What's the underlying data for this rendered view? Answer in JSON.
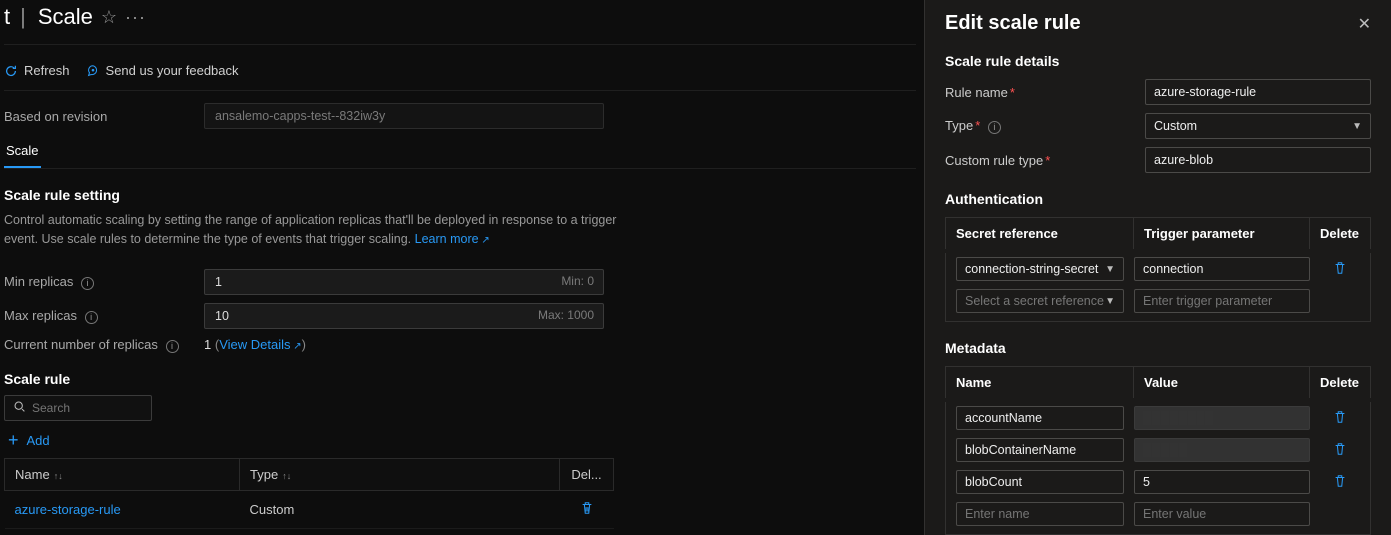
{
  "breadcrumb": {
    "suffix": "t",
    "page": "Scale"
  },
  "toolbar": {
    "refresh": "Refresh",
    "feedback": "Send us your feedback"
  },
  "revision": {
    "label": "Based on revision",
    "value": "ansalemo-capps-test--832iw3y"
  },
  "tabs": {
    "scale": "Scale"
  },
  "setting_header": "Scale rule setting",
  "setting_desc": "Control automatic scaling by setting the range of application replicas that'll be deployed in response to a trigger event. Use scale rules to determine the type of events that trigger scaling.",
  "learn_more": "Learn more",
  "min": {
    "label": "Min replicas",
    "value": "1",
    "hint": "Min: 0"
  },
  "max": {
    "label": "Max replicas",
    "value": "10",
    "hint": "Max: 1000"
  },
  "replicas": {
    "label": "Current number of replicas",
    "count": "1",
    "details": "View Details"
  },
  "scale_rule_header": "Scale rule",
  "search_placeholder": "Search",
  "add_label": "Add",
  "table": {
    "headers": {
      "name": "Name",
      "type": "Type",
      "del": "Del..."
    },
    "row0": {
      "name": "azure-storage-rule",
      "type": "Custom"
    }
  },
  "panel": {
    "title": "Edit scale rule",
    "details_header": "Scale rule details",
    "rule_name_label": "Rule name",
    "rule_name_value": "azure-storage-rule",
    "type_label": "Type",
    "type_value": "Custom",
    "custom_type_label": "Custom rule type",
    "custom_type_value": "azure-blob",
    "auth_header": "Authentication",
    "auth_cols": {
      "secret": "Secret reference",
      "trigger": "Trigger parameter",
      "del": "Delete"
    },
    "auth0": {
      "secret": "connection-string-secret",
      "trigger": "connection"
    },
    "auth_new_secret": "Select a secret reference",
    "auth_new_trigger": "Enter trigger parameter",
    "meta_header": "Metadata",
    "meta_cols": {
      "name": "Name",
      "value": "Value",
      "del": "Delete"
    },
    "meta0": {
      "name": "accountName",
      "value": ""
    },
    "meta1": {
      "name": "blobContainerName",
      "value": ""
    },
    "meta2": {
      "name": "blobCount",
      "value": "5"
    },
    "meta_new_name": "Enter name",
    "meta_new_value": "Enter value"
  }
}
